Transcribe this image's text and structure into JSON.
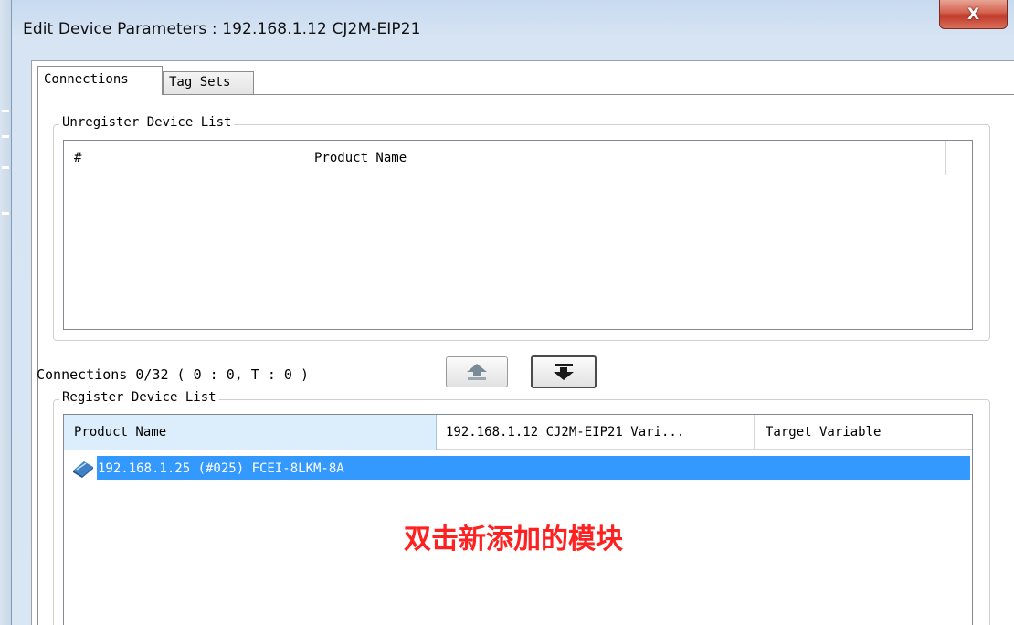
{
  "window": {
    "title": "Edit Device Parameters : 192.168.1.12 CJ2M-EIP21",
    "close_label": "X"
  },
  "tabs": [
    {
      "label": "Connections",
      "selected": true
    },
    {
      "label": "Tag Sets",
      "selected": false
    }
  ],
  "unregister_group": {
    "label": "Unregister Device List",
    "columns": [
      "#",
      "Product Name"
    ],
    "rows": []
  },
  "connections": {
    "status_text": "Connections 0/32 ( 0 : 0, T : 0 )",
    "buttons": [
      {
        "icon": "move-up-icon"
      },
      {
        "icon": "move-down-icon"
      }
    ]
  },
  "register_group": {
    "label": "Register Device List",
    "columns": [
      "Product Name",
      "192.168.1.12 CJ2M-EIP21 Vari...",
      "Target Variable"
    ],
    "rows": [
      {
        "icon": "device-icon",
        "product_name": "192.168.1.25  (#025) FCEI-8LKM-8A",
        "selected": true
      }
    ]
  },
  "annotation": {
    "text": "双击新添加的模块",
    "color": "#ff2020"
  },
  "colors": {
    "selection": "#3399ff",
    "header_highlight": "#dceefb"
  }
}
